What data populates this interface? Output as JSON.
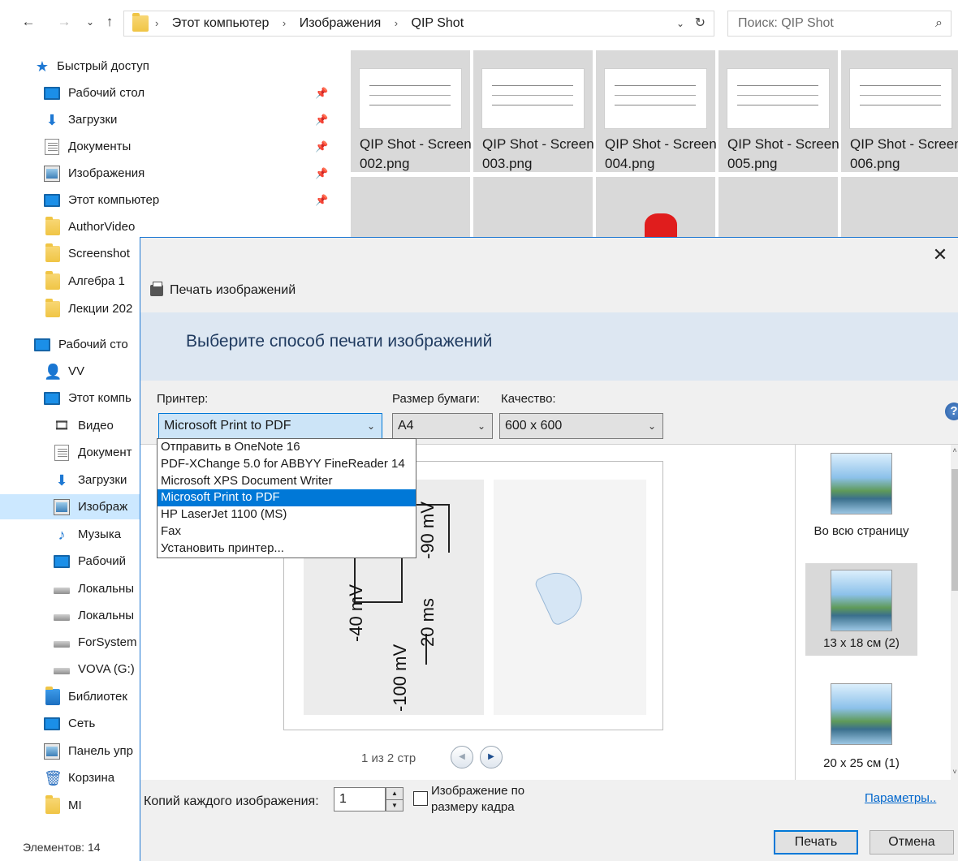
{
  "explorer": {
    "breadcrumb": [
      "Этот компьютер",
      "Изображения",
      "QIP Shot"
    ],
    "search_placeholder": "Поиск: QIP Shot",
    "status": "Элементов: 14"
  },
  "sidebar": {
    "quick_access": "Быстрый доступ",
    "pinned": [
      {
        "label": "Рабочий стол",
        "icon": "desktop-icon"
      },
      {
        "label": "Загрузки",
        "icon": "downloads-icon"
      },
      {
        "label": "Документы",
        "icon": "documents-icon"
      },
      {
        "label": "Изображения",
        "icon": "pictures-icon"
      },
      {
        "label": "Этот компьютер",
        "icon": "computer-icon"
      }
    ],
    "folders": [
      "AuthorVideo",
      "Screenshot",
      "Алгебра 1",
      "Лекции 202"
    ],
    "desktop": "Рабочий сто",
    "user": "VV",
    "this_pc": "Этот компь",
    "pc_items": [
      "Видео",
      "Документ",
      "Загрузки",
      "Изображ",
      "Музыка",
      "Рабочий",
      "Локальны",
      "Локальны",
      "ForSystem",
      "VOVA (G:)"
    ],
    "libraries": "Библиотек",
    "network": "Сеть",
    "control_panel": "Панель упр",
    "recycle": "Корзина",
    "mi": "MI"
  },
  "thumbnails": [
    {
      "name": "QIP Shot - Screen 002.png"
    },
    {
      "name": "QIP Shot - Screen 003.png"
    },
    {
      "name": "QIP Shot - Screen 004.png"
    },
    {
      "name": "QIP Shot - Screen 005.png"
    },
    {
      "name": "QIP Shot - Screen 006.png"
    }
  ],
  "dialog": {
    "title": "Печать изображений",
    "heading": "Выберите способ печати изображений",
    "printer_label": "Принтер:",
    "printer_value": "Microsoft Print to PDF",
    "paper_label": "Размер бумаги:",
    "paper_value": "A4",
    "quality_label": "Качество:",
    "quality_value": "600 x 600",
    "printer_options": [
      "Отправить в OneNote 16",
      "PDF-XChange 5.0 for ABBYY FineReader 14",
      "Microsoft XPS Document Writer",
      "Microsoft Print to PDF",
      "HP LaserJet 1100 (MS)",
      "Fax",
      "Установить принтер..."
    ],
    "selected_option_index": 3,
    "preview": {
      "pager": "1 из 2 стр",
      "labels": [
        "-40 mV",
        "-100 mV",
        "20 ms",
        "-90 mV"
      ]
    },
    "layouts": [
      "Во всю страницу",
      "13 x 18 см (2)",
      "20 x 25 см (1)"
    ],
    "copies_label": "Копий каждого изображения:",
    "copies_value": "1",
    "fit_label": "Изображение по размеру кадра",
    "params_link": "Параметры..",
    "print_button": "Печать",
    "cancel_button": "Отмена"
  },
  "colors": {
    "accent": "#0078d7",
    "banner": "#dde7f2",
    "selection": "#cce8ff"
  }
}
